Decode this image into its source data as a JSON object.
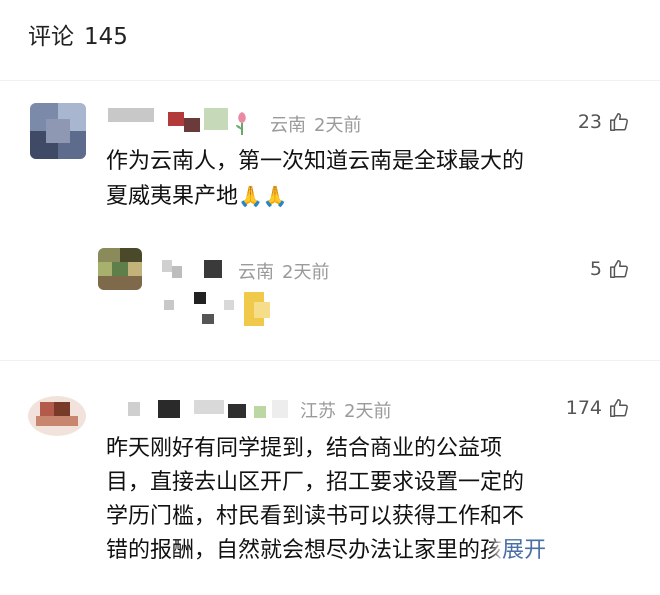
{
  "header": {
    "title": "评论",
    "count": "145"
  },
  "comments": [
    {
      "location": "云南",
      "time": "2天前",
      "likes": "23",
      "line1": "作为云南人，第一次知道云南是全球最大的",
      "line2": "夏威夷果产地",
      "emoji": "🙏🙏"
    },
    {
      "location": "云南",
      "time": "2天前",
      "likes": "5"
    },
    {
      "location": "江苏",
      "time": "2天前",
      "likes": "174",
      "line1": "昨天刚好有同学提到，结合商业的公益项",
      "line2": "目，直接去山区开厂，招工要求设置一定的",
      "line3": "学历门槛，村民看到读书可以获得工作和不",
      "line4": "错的报酬，自然就会想尽办法让家里的",
      "line4_fade": "孩",
      "expand": "展开"
    }
  ],
  "icons": {
    "like": "thumbs-up-icon",
    "flower": "tulip-icon"
  },
  "colors": {
    "meta": "#9a9a9a",
    "link": "#4a6fa5",
    "text": "#111111"
  }
}
